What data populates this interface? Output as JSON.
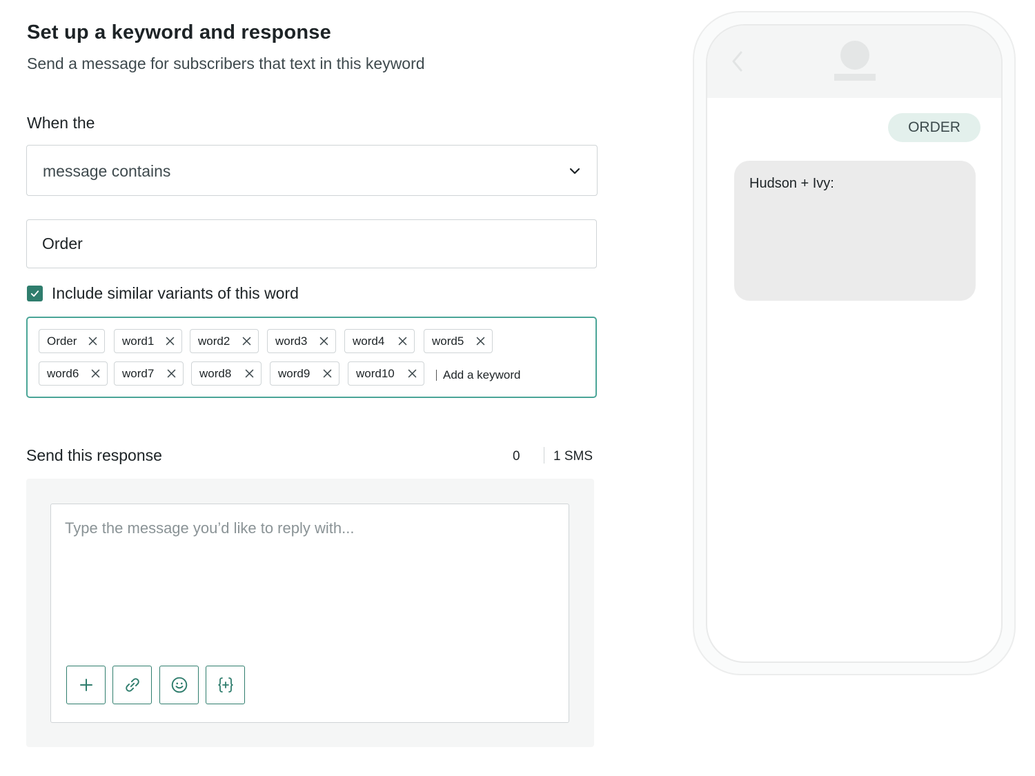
{
  "header": {
    "title": "Set up a keyword and response",
    "subtitle": "Send a message for subscribers that text in this keyword"
  },
  "trigger": {
    "label": "When the",
    "condition_value": "message contains",
    "keyword_value": "Order",
    "include_variants_label": "Include similar variants of this word",
    "include_variants_checked": true
  },
  "variants": {
    "chips": [
      "Order",
      "word1",
      "word2",
      "word3",
      "word4",
      "word5",
      "word6",
      "word7",
      "word8",
      "word9",
      "word10"
    ],
    "add_placeholder": "Add a keyword"
  },
  "response": {
    "label": "Send this response",
    "char_count": "0",
    "sms_count": "1 SMS",
    "placeholder": "Type the message you’d like to reply with...",
    "tools": [
      "plus-icon",
      "link-icon",
      "emoji-icon",
      "variable-icon"
    ]
  },
  "preview": {
    "incoming_keyword": "ORDER",
    "reply_sender": "Hudson + Ivy:"
  },
  "colors": {
    "accent": "#2f7d6d",
    "focus_border": "#4aa597",
    "keyword_bubble": "#e3f0ec",
    "reply_bubble": "#ebebeb"
  }
}
